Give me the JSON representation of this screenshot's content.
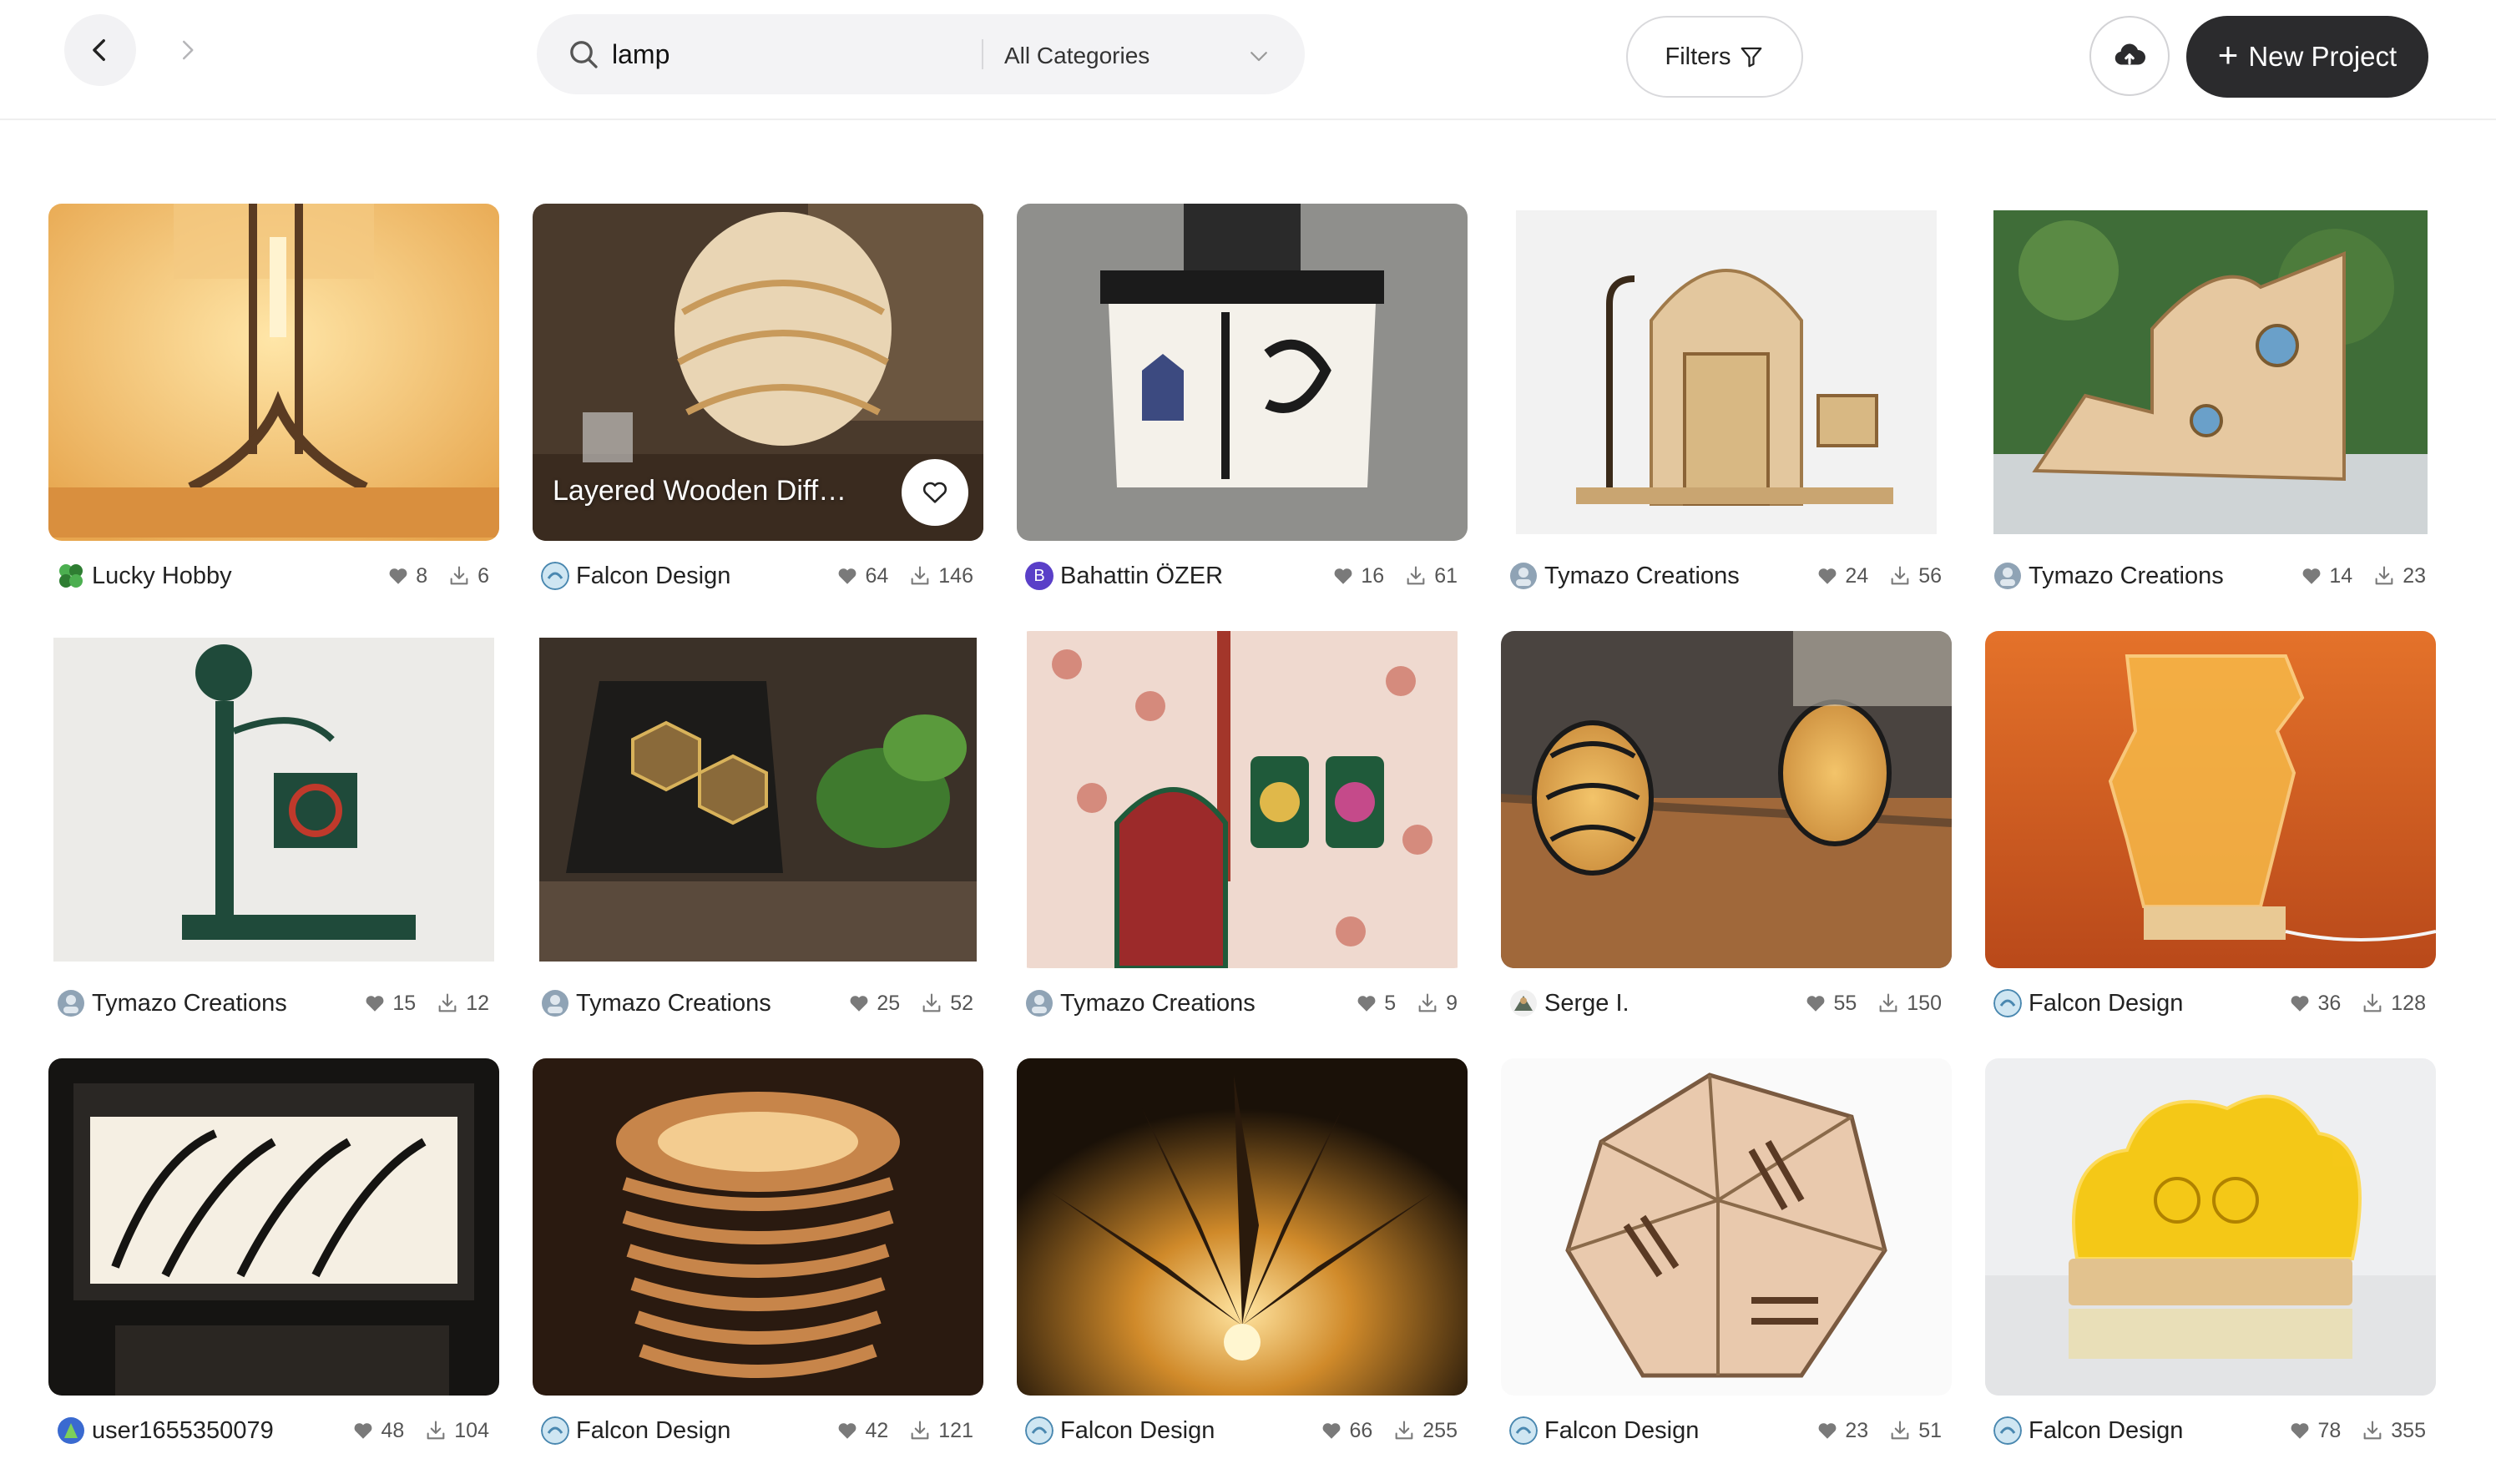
{
  "topbar": {
    "search": {
      "value": "lamp",
      "placeholder": "Search"
    },
    "category": "All Categories",
    "filters_label": "Filters",
    "new_project_label": "New Project"
  },
  "colors": {
    "accent_dark": "#2b2b2d",
    "like_icon": "#7a7a7a"
  },
  "cards": [
    {
      "author": "Lucky Hobby",
      "likes": "8",
      "downloads": "6"
    },
    {
      "author": "Falcon Design",
      "likes": "64",
      "downloads": "146",
      "hover_title": "Layered Wooden Diff…"
    },
    {
      "author": "Bahattin ÖZER",
      "likes": "16",
      "downloads": "61",
      "avatar_letter": "B"
    },
    {
      "author": "Tymazo Creations",
      "likes": "24",
      "downloads": "56"
    },
    {
      "author": "Tymazo Creations",
      "likes": "14",
      "downloads": "23"
    },
    {
      "author": "Tymazo Creations",
      "likes": "15",
      "downloads": "12"
    },
    {
      "author": "Tymazo Creations",
      "likes": "25",
      "downloads": "52"
    },
    {
      "author": "Tymazo Creations",
      "likes": "5",
      "downloads": "9"
    },
    {
      "author": "Serge I.",
      "likes": "55",
      "downloads": "150"
    },
    {
      "author": "Falcon Design",
      "likes": "36",
      "downloads": "128"
    },
    {
      "author": "user1655350079",
      "likes": "48",
      "downloads": "104"
    },
    {
      "author": "Falcon Design",
      "likes": "42",
      "downloads": "121"
    },
    {
      "author": "Falcon Design",
      "likes": "66",
      "downloads": "255"
    },
    {
      "author": "Falcon Design",
      "likes": "23",
      "downloads": "51"
    },
    {
      "author": "Falcon Design",
      "likes": "78",
      "downloads": "355"
    }
  ]
}
